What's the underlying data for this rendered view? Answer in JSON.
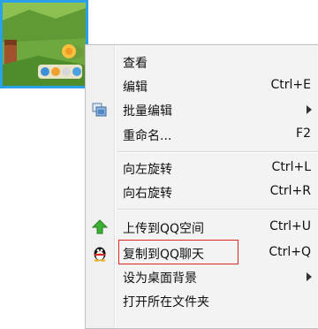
{
  "menu": {
    "items": [
      {
        "label": "查看",
        "shortcut": ""
      },
      {
        "label": "编辑",
        "shortcut": "Ctrl+E"
      },
      {
        "label": "批量编辑",
        "shortcut": "",
        "icon": "batch-edit-icon",
        "submenu": true
      },
      {
        "label": "重命名...",
        "shortcut": "F2"
      },
      {
        "label": "向左旋转",
        "shortcut": "Ctrl+L"
      },
      {
        "label": "向右旋转",
        "shortcut": "Ctrl+R"
      },
      {
        "label": "上传到QQ空间",
        "shortcut": "Ctrl+U",
        "icon": "upload-arrow-icon"
      },
      {
        "label": "复制到QQ聊天",
        "shortcut": "Ctrl+Q",
        "icon": "qq-penguin-icon",
        "highlighted": true
      },
      {
        "label": "设为桌面背景",
        "shortcut": "",
        "submenu": true
      },
      {
        "label": "打开所在文件夹",
        "shortcut": ""
      }
    ]
  },
  "colors": {
    "selection_border": "#2aa0e8",
    "highlight_box": "#e02525",
    "upload_arrow": "#3cb034"
  }
}
